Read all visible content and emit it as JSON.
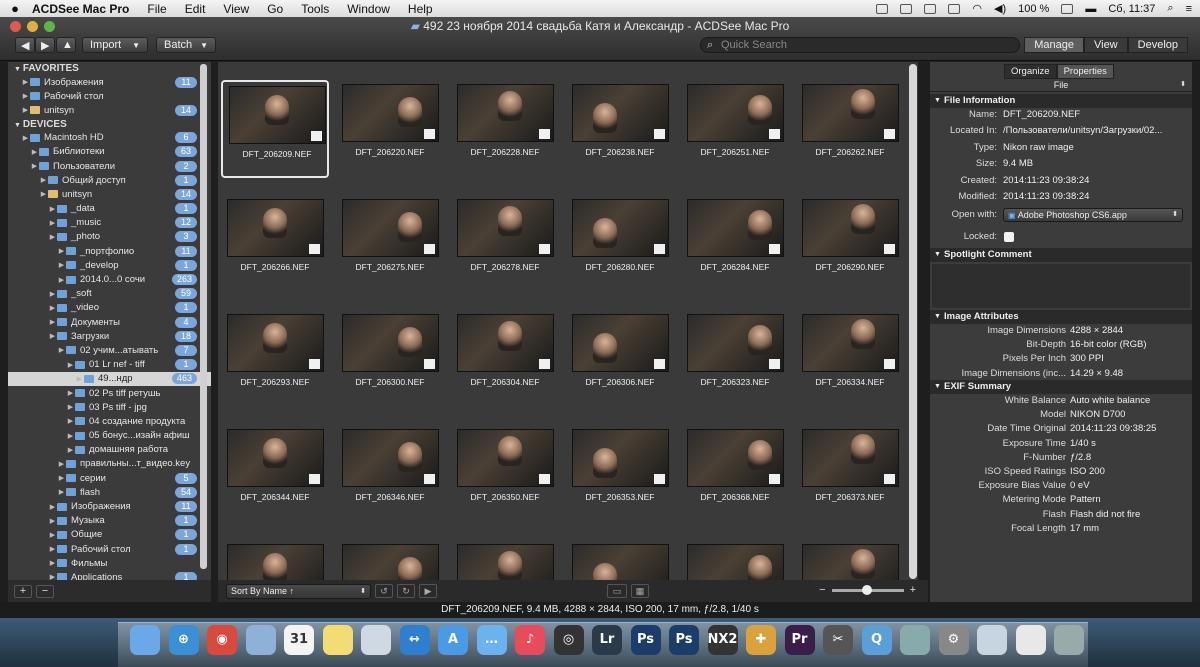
{
  "menubar": {
    "app": "ACDSee Mac Pro",
    "items": [
      "File",
      "Edit",
      "View",
      "Go",
      "Tools",
      "Window",
      "Help"
    ],
    "battery": "100 %",
    "clock": "Сб, 11:37"
  },
  "window": {
    "title": "492 23 ноября 2014 свадьба Катя и Александр - ACDSee Mac Pro"
  },
  "toolbar": {
    "import": "Import",
    "batch": "Batch",
    "search_placeholder": "Quick Search",
    "modes": [
      "Manage",
      "View",
      "Develop"
    ]
  },
  "sidebar": {
    "favorites_header": "FAVORITES",
    "devices_header": "DEVICES",
    "favorites": [
      {
        "label": "Изображения",
        "count": "11"
      },
      {
        "label": "Рабочий стол",
        "count": ""
      },
      {
        "label": "unitsyn",
        "count": "14"
      }
    ],
    "devices": [
      {
        "label": "Macintosh HD",
        "count": "6",
        "indent": 1
      },
      {
        "label": "Библиотеки",
        "count": "63",
        "indent": 2
      },
      {
        "label": "Пользователи",
        "count": "2",
        "indent": 2
      },
      {
        "label": "Общий доступ",
        "count": "1",
        "indent": 3
      },
      {
        "label": "unitsyn",
        "count": "14",
        "indent": 3
      },
      {
        "label": "_data",
        "count": "1",
        "indent": 4
      },
      {
        "label": "_music",
        "count": "12",
        "indent": 4
      },
      {
        "label": "_photo",
        "count": "3",
        "indent": 4
      },
      {
        "label": "_портфолио",
        "count": "11",
        "indent": 5
      },
      {
        "label": "_develop",
        "count": "1",
        "indent": 5
      },
      {
        "label": "2014.0...0 сочи",
        "count": "263",
        "indent": 5
      },
      {
        "label": "_soft",
        "count": "59",
        "indent": 4
      },
      {
        "label": "_video",
        "count": "1",
        "indent": 4
      },
      {
        "label": "Документы",
        "count": "4",
        "indent": 4
      },
      {
        "label": "Загрузки",
        "count": "18",
        "indent": 4
      },
      {
        "label": "02 учим...атывать",
        "count": "7",
        "indent": 5
      },
      {
        "label": "01 Lr nef - tiff",
        "count": "1",
        "indent": 6
      },
      {
        "label": "49...ндр",
        "count": "463",
        "indent": 7
      },
      {
        "label": "02 Ps tiff ретушь",
        "count": "",
        "indent": 6
      },
      {
        "label": "03 Ps tiff - jpg",
        "count": "",
        "indent": 6
      },
      {
        "label": "04 создание продукта",
        "count": "",
        "indent": 6
      },
      {
        "label": "05 бонус...изайн афиш",
        "count": "",
        "indent": 6
      },
      {
        "label": "домашняя работа",
        "count": "",
        "indent": 6
      },
      {
        "label": "правильны...т_видео.key",
        "count": "",
        "indent": 5
      },
      {
        "label": "серии",
        "count": "5",
        "indent": 5
      },
      {
        "label": "flash",
        "count": "54",
        "indent": 5
      },
      {
        "label": "Изображения",
        "count": "11",
        "indent": 4
      },
      {
        "label": "Музыка",
        "count": "1",
        "indent": 4
      },
      {
        "label": "Общие",
        "count": "1",
        "indent": 4
      },
      {
        "label": "Рабочий стол",
        "count": "1",
        "indent": 4
      },
      {
        "label": "Фильмы",
        "count": "",
        "indent": 4
      },
      {
        "label": "Applications",
        "count": "1",
        "indent": 4
      }
    ]
  },
  "grid": {
    "items": [
      "DFT_206209.NEF",
      "DFT_206220.NEF",
      "DFT_206228.NEF",
      "DFT_206238.NEF",
      "DFT_206251.NEF",
      "DFT_206262.NEF",
      "DFT_206266.NEF",
      "DFT_206275.NEF",
      "DFT_206278.NEF",
      "DFT_206280.NEF",
      "DFT_206284.NEF",
      "DFT_206290.NEF",
      "DFT_206293.NEF",
      "DFT_206300.NEF",
      "DFT_206304.NEF",
      "DFT_206306.NEF",
      "DFT_206323.NEF",
      "DFT_206334.NEF",
      "DFT_206344.NEF",
      "DFT_206346.NEF",
      "DFT_206350.NEF",
      "DFT_206353.NEF",
      "DFT_206368.NEF",
      "DFT_206373.NEF",
      "",
      "",
      "",
      "",
      "",
      ""
    ],
    "selected_index": 0,
    "sort": "Sort By Name ↑"
  },
  "statusbar": "DFT_206209.NEF, 9.4 MB, 4288 × 2844, ISO 200, 17 mm, ƒ/2.8, 1/40 s",
  "panel": {
    "tabs": [
      "Organize",
      "Properties"
    ],
    "active_tab": "Properties",
    "file_select": "File",
    "file_info_header": "File Information",
    "file_info": [
      {
        "k": "Name:",
        "v": "DFT_206209.NEF"
      },
      {
        "k": "Located In:",
        "v": "/Пользователи/unitsyn/Загрузки/02..."
      },
      {
        "k": "Type:",
        "v": "Nikon raw image"
      },
      {
        "k": "Size:",
        "v": "9.4 MB"
      },
      {
        "k": "Created:",
        "v": "2014:11:23 09:38:24"
      },
      {
        "k": "Modified:",
        "v": "2014:11:23 09:38:24"
      }
    ],
    "open_with_label": "Open with:",
    "open_with_value": "Adobe Photoshop CS6.app",
    "locked_label": "Locked:",
    "spotlight_header": "Spotlight Comment",
    "attr_header": "Image Attributes",
    "attributes": [
      {
        "k": "Image Dimensions",
        "v": "4288 × 2844"
      },
      {
        "k": "Bit-Depth",
        "v": "16-bit color (RGB)"
      },
      {
        "k": "Pixels Per Inch",
        "v": "300 PPI"
      },
      {
        "k": "Image Dimensions (inc...",
        "v": "14.29 × 9.48"
      }
    ],
    "exif_header": "EXIF Summary",
    "exif": [
      {
        "k": "White Balance",
        "v": "Auto white balance"
      },
      {
        "k": "Model",
        "v": "NIKON D700"
      },
      {
        "k": "Date Time Original",
        "v": "2014:11:23 09:38:25"
      },
      {
        "k": "Exposure Time",
        "v": "1/40 s"
      },
      {
        "k": "F-Number",
        "v": "ƒ/2.8"
      },
      {
        "k": "ISO Speed Ratings",
        "v": "ISO 200"
      },
      {
        "k": "Exposure Bias Value",
        "v": "0 eV"
      },
      {
        "k": "Metering Mode",
        "v": "Pattern"
      },
      {
        "k": "Flash",
        "v": "Flash did not fire"
      },
      {
        "k": "Focal Length",
        "v": "17 mm"
      }
    ]
  },
  "dock": [
    {
      "name": "finder-icon",
      "color": "#6aa9e8",
      "glyph": ""
    },
    {
      "name": "safari-icon",
      "color": "#3b8fd6",
      "glyph": "⊕"
    },
    {
      "name": "chrome-icon",
      "color": "#d94a3c",
      "glyph": "◉"
    },
    {
      "name": "preview-icon",
      "color": "#8fb0d8",
      "glyph": ""
    },
    {
      "name": "calendar-icon",
      "color": "#f4f4f4",
      "glyph": "31"
    },
    {
      "name": "notes-icon",
      "color": "#f2dc74",
      "glyph": ""
    },
    {
      "name": "disk-icon",
      "color": "#cfd8e3",
      "glyph": ""
    },
    {
      "name": "teamviewer-icon",
      "color": "#2f7fd0",
      "glyph": "↔"
    },
    {
      "name": "appstore-icon",
      "color": "#4a9ae6",
      "glyph": "A"
    },
    {
      "name": "messages-icon",
      "color": "#6bb3f0",
      "glyph": "…"
    },
    {
      "name": "music-icon",
      "color": "#e84b5a",
      "glyph": "♪"
    },
    {
      "name": "aperture-icon",
      "color": "#333",
      "glyph": "◎"
    },
    {
      "name": "lightroom-icon",
      "color": "#2b3a4a",
      "glyph": "Lr"
    },
    {
      "name": "photoshop-icon",
      "color": "#1c3c6c",
      "glyph": "Ps"
    },
    {
      "name": "photoshop2-icon",
      "color": "#1c3c6c",
      "glyph": "Ps"
    },
    {
      "name": "nx2-icon",
      "color": "#333",
      "glyph": "NX2"
    },
    {
      "name": "nik-icon",
      "color": "#d9a23a",
      "glyph": "✚"
    },
    {
      "name": "premiere-icon",
      "color": "#3a1e4a",
      "glyph": "Pr"
    },
    {
      "name": "finalcut-icon",
      "color": "#555",
      "glyph": "✂"
    },
    {
      "name": "quicktime-icon",
      "color": "#5a9fd8",
      "glyph": "Q"
    },
    {
      "name": "monitor-icon",
      "color": "#8aa",
      "glyph": ""
    },
    {
      "name": "sysprefs-icon",
      "color": "#888",
      "glyph": "⚙"
    },
    {
      "name": "iphoto-icon",
      "color": "#c8d4e0",
      "glyph": ""
    },
    {
      "name": "documents-icon",
      "color": "#e8e8e8",
      "glyph": ""
    },
    {
      "name": "trash-icon",
      "color": "#9aa",
      "glyph": ""
    }
  ]
}
